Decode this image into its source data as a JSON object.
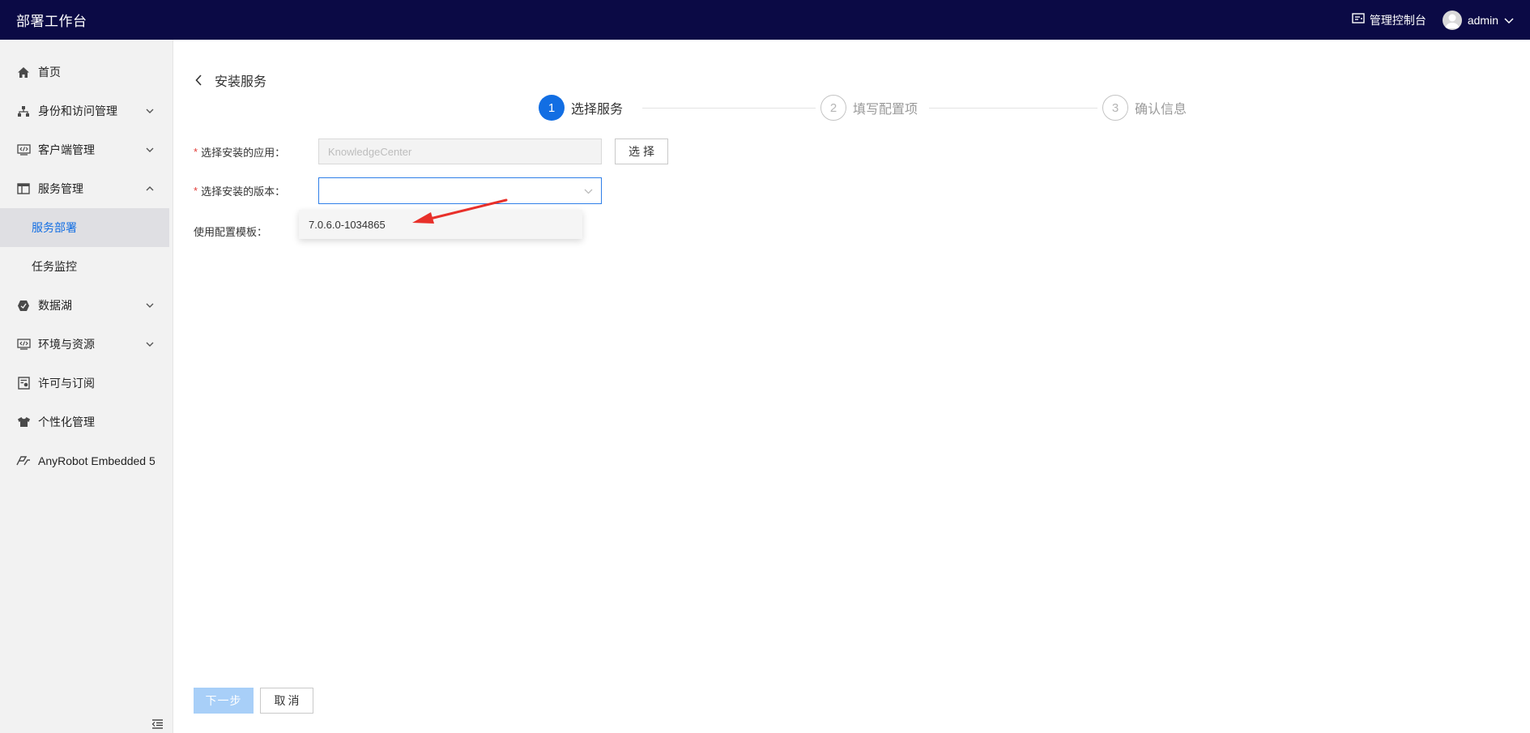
{
  "header": {
    "app_title": "部署工作台",
    "console_label": "管理控制台",
    "username": "admin",
    "bg_color": "#0b0a45"
  },
  "sidebar": {
    "items": [
      {
        "label": "首页",
        "icon": "home-icon"
      },
      {
        "label": "身份和访问管理",
        "icon": "org-tree-icon",
        "expandable": true,
        "expanded": false
      },
      {
        "label": "客户端管理",
        "icon": "code-window-icon",
        "expandable": true,
        "expanded": false
      },
      {
        "label": "服务管理",
        "icon": "layout-icon",
        "expandable": true,
        "expanded": true
      },
      {
        "label": "数据湖",
        "icon": "hexagon-icon",
        "expandable": true,
        "expanded": false
      },
      {
        "label": "环境与资源",
        "icon": "code-window-icon",
        "expandable": true,
        "expanded": false
      },
      {
        "label": "许可与订阅",
        "icon": "license-icon"
      },
      {
        "label": "个性化管理",
        "icon": "shirt-icon"
      },
      {
        "label": "AnyRobot Embedded 5",
        "icon": "anyrobot-icon"
      }
    ],
    "sub_items": [
      {
        "label": "服务部署",
        "active": true
      },
      {
        "label": "任务监控",
        "active": false
      }
    ]
  },
  "page": {
    "title": "安装服务"
  },
  "steps": [
    {
      "number": "1",
      "label": "选择服务",
      "status": "active"
    },
    {
      "number": "2",
      "label": "填写配置项",
      "status": "pending"
    },
    {
      "number": "3",
      "label": "确认信息",
      "status": "pending"
    }
  ],
  "form": {
    "app_label": "选择安装的应用：",
    "app_value": "KnowledgeCenter",
    "select_button": "选择",
    "version_label": "选择安装的版本：",
    "version_value": "",
    "version_options": [
      "7.0.6.0-1034865"
    ],
    "template_label": "使用配置模板："
  },
  "footer": {
    "next_label": "下一步",
    "cancel_label": "取消"
  },
  "colors": {
    "primary": "#126ee3",
    "required": "#e23c39",
    "annotation": "#e8302a"
  }
}
